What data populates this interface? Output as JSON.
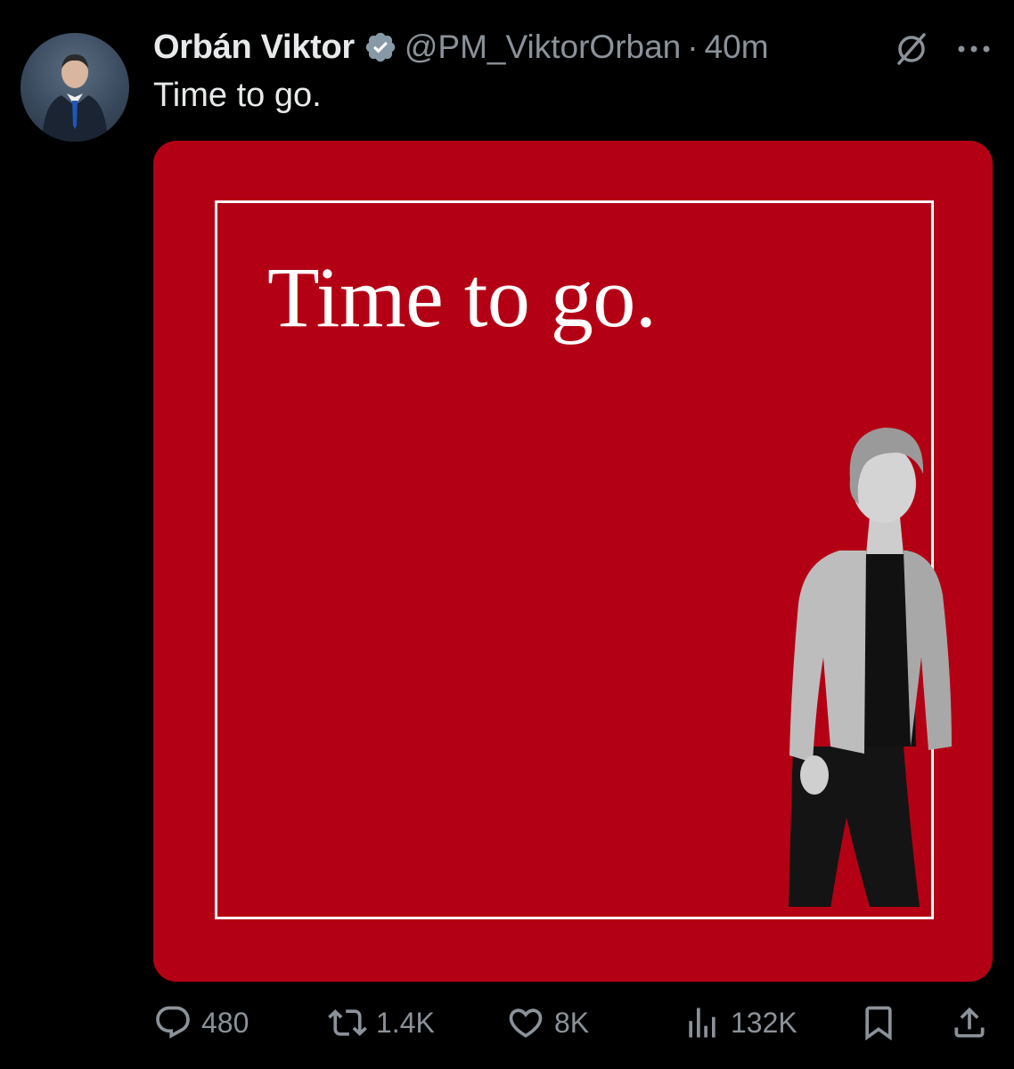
{
  "author": {
    "name": "Orbán Viktor",
    "handle": "@PM_ViktorOrban",
    "separator": "·",
    "time": "40m",
    "verified": true,
    "accent": "#8899a6"
  },
  "tweet": {
    "text": "Time to go."
  },
  "media": {
    "headline": "Time to go.",
    "background": "#b40014"
  },
  "icons": {
    "grok": "grok-icon",
    "more": "more-icon",
    "reply": "reply-icon",
    "retweet": "retweet-icon",
    "like": "heart-icon",
    "views": "views-icon",
    "bookmark": "bookmark-icon",
    "share": "share-icon"
  },
  "actions": {
    "replies": "480",
    "retweets": "1.4K",
    "likes": "8K",
    "views": "132K"
  }
}
